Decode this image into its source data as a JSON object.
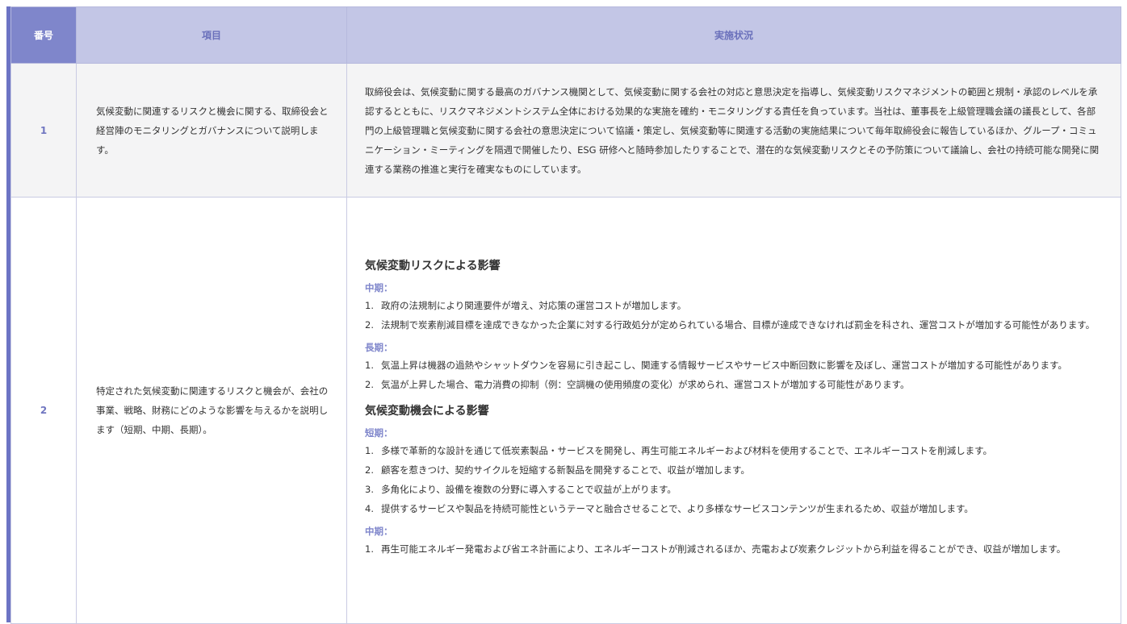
{
  "table": {
    "headers": {
      "number": "番号",
      "item": "項目",
      "status": "実施状況"
    },
    "rows": [
      {
        "number": "1",
        "item": "気候変動に関連するリスクと機会に関する、取締役会と経営陣のモニタリングとガバナンスについて説明します。",
        "status": "取締役会は、気候変動に関する最高のガバナンス機関として、気候変動に関する会社の対応と意思決定を指導し、気候変動リスクマネジメントの範囲と規制・承認のレベルを承認するとともに、リスクマネジメントシステム全体における効果的な実施を確約・モニタリングする責任を負っています。当社は、董事長を上級管理職会議の議長として、各部門の上級管理職と気候変動に関する会社の意思決定について協議・策定し、気候変動等に関連する活動の実施結果について毎年取締役会に報告しているほか、グループ・コミュニケーション・ミーティングを隔週で開催したり、ESG 研修へと随時参加したりすることで、潜在的な気候変動リスクとその予防策について議論し、会社の持続可能な開発に関連する業務の推進と実行を確実なものにしています。"
      },
      {
        "number": "2",
        "item": "特定された気候変動に関連するリスクと機会が、会社の事業、戦略、財務にどのような影響を与えるかを説明します（短期、中期、長期）。",
        "risk": {
          "heading": "気候変動リスクによる影響",
          "mid_label": "中期：",
          "mid": [
            {
              "n": "1.",
              "text": "政府の法規制により関連要件が増え、対応策の運営コストが増加します。"
            },
            {
              "n": "2.",
              "text": "法規制で炭素削減目標を達成できなかった企業に対する行政処分が定められている場合、目標が達成できなければ罰金を科され、運営コストが増加する可能性があります。"
            }
          ],
          "long_label": "長期：",
          "long": [
            {
              "n": "1.",
              "text": "気温上昇は機器の過熱やシャットダウンを容易に引き起こし、関連する情報サービスやサービス中断回数に影響を及ぼし、運営コストが増加する可能性があります。"
            },
            {
              "n": "2.",
              "text": "気温が上昇した場合、電力消費の抑制（例：空調機の使用頻度の変化）が求められ、運営コストが増加する可能性があります。"
            }
          ]
        },
        "opportunity": {
          "heading": "気候変動機会による影響",
          "short_label": "短期：",
          "short": [
            {
              "n": "1.",
              "text": "多様で革新的な設計を通じて低炭素製品・サービスを開発し、再生可能エネルギーおよび材料を使用することで、エネルギーコストを削減します。"
            },
            {
              "n": "2.",
              "text": "顧客を惹きつけ、契約サイクルを短縮する新製品を開発することで、収益が増加します。"
            },
            {
              "n": "3.",
              "text": "多角化により、設備を複数の分野に導入することで収益が上がります。"
            },
            {
              "n": "4.",
              "text": "提供するサービスや製品を持続可能性というテーマと融合させることで、より多様なサービスコンテンツが生まれるため、収益が増加します。"
            }
          ],
          "mid_label": "中期：",
          "mid": [
            {
              "n": "1.",
              "text": "再生可能エネルギー発電および省エネ計画により、エネルギーコストが削減されるほか、売電および炭素クレジットから利益を得ることができ、収益が増加します。"
            }
          ]
        }
      }
    ]
  },
  "colors": {
    "accent": "#7f86cb",
    "header_bg": "#c3c6e6",
    "left_bar": "#6c74c4"
  }
}
